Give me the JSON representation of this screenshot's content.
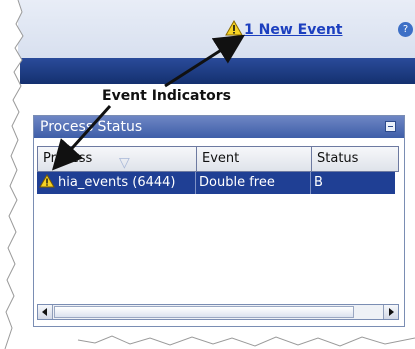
{
  "toolbar": {
    "events_link_label": "1 New Event",
    "help_icon": "?"
  },
  "annotation": {
    "label": "Event Indicators"
  },
  "process_status": {
    "title": "Process Status",
    "columns": [
      "Process",
      "Event",
      "Status"
    ],
    "rows": [
      {
        "process": "hia_events (6444)",
        "event": "Double free",
        "status": "B"
      }
    ]
  },
  "icons": {
    "warning": "warning-triangle-icon",
    "sort": "sort-icon"
  },
  "colors": {
    "link": "#1c3fbf",
    "title_bar": "#3e5ea8",
    "selected_row": "#1f3f94"
  }
}
